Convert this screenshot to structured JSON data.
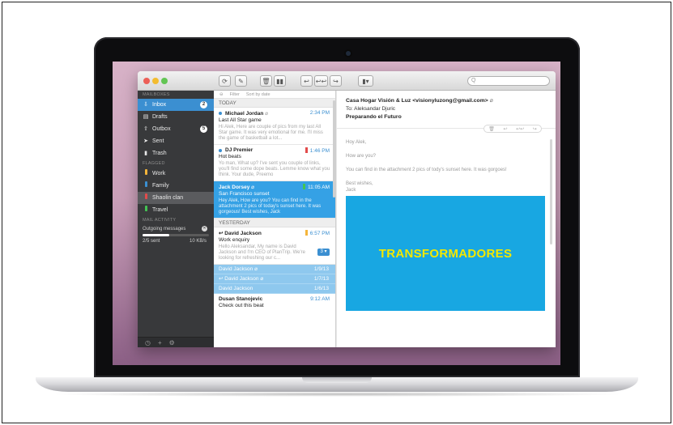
{
  "toolbar": {
    "buttons": [
      "⟳",
      "✎",
      "🗑",
      "▮▮",
      "↩",
      "↩↩",
      "↪",
      "▮▾"
    ],
    "search_placeholder": "Q"
  },
  "sidebar": {
    "mailboxes_label": "MAILBOXES",
    "items": [
      {
        "icon": "inbox-icon",
        "label": "Inbox",
        "badge": "2"
      },
      {
        "icon": "drafts-icon",
        "label": "Drafts"
      },
      {
        "icon": "outbox-icon",
        "label": "Outbox",
        "badge": "5"
      },
      {
        "icon": "sent-icon",
        "label": "Sent"
      },
      {
        "icon": "trash-icon",
        "label": "Trash"
      }
    ],
    "flagged_label": "FLAGGED",
    "flagged": [
      {
        "label": "Work",
        "color": "#f5b53a"
      },
      {
        "label": "Family",
        "color": "#3b8fd1"
      },
      {
        "label": "Shaolin clan",
        "color": "#e24b4b"
      },
      {
        "label": "Travel",
        "color": "#43c353"
      }
    ],
    "activity_label": "MAIL ACTIVITY",
    "outgoing_label": "Outgoing messages",
    "progress": 0.4,
    "sent_status": "2/5 sent",
    "speed": "10 KB/s"
  },
  "list": {
    "filter_label": "Filter",
    "sort_label": "Sort by date",
    "today_label": "TODAY",
    "yesterday_label": "YESTERDAY",
    "messages": [
      {
        "from": "Michael Jordan",
        "time": "2:34 PM",
        "subject": "Last All Star game",
        "preview": "Hi Alek, Here are couple of pics from my last All Star game. It was very emotional for me. I'll miss the game of basketball a lot..."
      },
      {
        "from": "DJ Premier",
        "time": "1:46 PM",
        "subject": "Hot beats",
        "preview": "Yo man, What up? I've sent you couple of links, you'll find some dope beats. Lemme know what you think. Your dude, Preemo"
      },
      {
        "from": "Jack Dorsey",
        "time": "11:05 AM",
        "subject": "San Francisco sunset",
        "preview": "Hey Alek, How are you? You can find in the attachment 2 pics of today's sunset here. It was gorgeous! Best wishes, Jack"
      },
      {
        "from": "David Jackson",
        "time": "6:57 PM",
        "subject": "Work enquiry",
        "preview": "Hello Aleksandar, My name is David Jackson and I'm CEO of PlanTrip. We're looking for refreshing our c...",
        "count": "3 ▾"
      }
    ],
    "thread": [
      {
        "from": "David Jackson",
        "date": "1/9/13"
      },
      {
        "from": "David Jackson",
        "date": "1/7/13"
      },
      {
        "from": "David Jackson",
        "date": "1/6/13"
      }
    ],
    "last": {
      "from": "Dusan Stanojevic",
      "time": "9:12 AM",
      "subject": "Check out this beat"
    }
  },
  "reader": {
    "from": "Casa Hogar Visión & Luz <visionyluzong@gmail.com>",
    "to": "To: Aleksandar Djuric",
    "subject": "Preparando el Futuro",
    "body": [
      "Hoy Alek,",
      "How are you?",
      "You can find in the attachment 2 pics of tody's sunset here. It was gorgoes!",
      "Best wishes,",
      "Jack"
    ],
    "banner_text": "TRANSFORMADORES"
  }
}
